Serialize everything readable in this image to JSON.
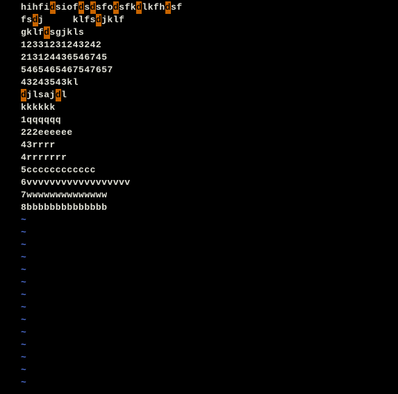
{
  "highlight_char": "d",
  "highlight_bg": "#c86400",
  "highlight_fg": "#000000",
  "tilde_color": "#4a6acc",
  "content_lines": [
    {
      "segments": [
        {
          "t": "hihfi",
          "h": false
        },
        {
          "t": "d",
          "h": true
        },
        {
          "t": "siof",
          "h": false
        },
        {
          "t": "d",
          "h": true
        },
        {
          "t": "s",
          "h": false
        },
        {
          "t": "d",
          "h": true
        },
        {
          "t": "sfo",
          "h": false
        },
        {
          "t": "d",
          "h": true
        },
        {
          "t": "sfk",
          "h": false
        },
        {
          "t": "d",
          "h": true
        },
        {
          "t": "lkfh",
          "h": false
        },
        {
          "t": "d",
          "h": true
        },
        {
          "t": "sf",
          "h": false
        }
      ]
    },
    {
      "segments": [
        {
          "t": "fs",
          "h": false
        },
        {
          "t": "d",
          "h": true
        },
        {
          "t": "j     klfs",
          "h": false
        },
        {
          "t": "d",
          "h": true
        },
        {
          "t": "jklf",
          "h": false
        }
      ]
    },
    {
      "segments": [
        {
          "t": "gklf",
          "h": false
        },
        {
          "t": "d",
          "h": true
        },
        {
          "t": "sgjkls",
          "h": false
        }
      ]
    },
    {
      "segments": [
        {
          "t": "12331231243242",
          "h": false
        }
      ]
    },
    {
      "segments": [
        {
          "t": "213124436546745",
          "h": false
        }
      ]
    },
    {
      "segments": [
        {
          "t": "5465465467547657",
          "h": false
        }
      ]
    },
    {
      "segments": [
        {
          "t": "43243543kl",
          "h": false
        }
      ]
    },
    {
      "segments": [
        {
          "t": "d",
          "h": true
        },
        {
          "t": "jlsaj",
          "h": false
        },
        {
          "t": "d",
          "h": true
        },
        {
          "t": "l",
          "h": false
        }
      ]
    },
    {
      "segments": [
        {
          "t": "kkkkkk",
          "h": false
        }
      ]
    },
    {
      "segments": [
        {
          "t": "1qqqqqq",
          "h": false
        }
      ]
    },
    {
      "segments": [
        {
          "t": "222eeeeee",
          "h": false
        }
      ]
    },
    {
      "segments": [
        {
          "t": "43rrrr",
          "h": false
        }
      ]
    },
    {
      "segments": [
        {
          "t": "4rrrrrrr",
          "h": false
        }
      ]
    },
    {
      "segments": [
        {
          "t": "5cccccccccccc",
          "h": false
        }
      ]
    },
    {
      "segments": [
        {
          "t": "6vvvvvvvvvvvvvvvvvv",
          "h": false
        }
      ]
    },
    {
      "segments": [
        {
          "t": "7wwwwwwwwwwwwww",
          "h": false
        }
      ]
    },
    {
      "segments": [
        {
          "t": "8bbbbbbbbbbbbbb",
          "h": false
        }
      ]
    }
  ],
  "tilde_char": "~",
  "tilde_count": 14
}
